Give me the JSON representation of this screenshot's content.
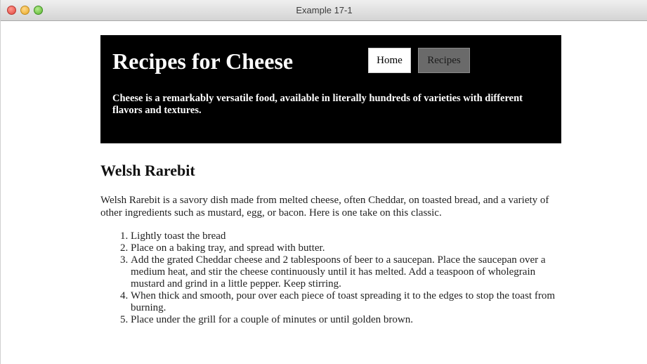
{
  "window": {
    "title": "Example 17-1"
  },
  "header": {
    "title": "Recipes for Cheese",
    "nav": {
      "home_label": "Home",
      "recipes_label": "Recipes"
    },
    "tagline": "Cheese is a remarkably versatile food, available in literally hundreds of varieties with different flavors and textures."
  },
  "article": {
    "title": "Welsh Rarebit",
    "intro": "Welsh Rarebit is a savory dish made from melted cheese, often Cheddar, on toasted bread, and a variety of other ingredients such as mustard, egg, or bacon. Here is one take on this classic.",
    "steps": [
      "Lightly toast the bread",
      "Place on a baking tray, and spread with butter.",
      "Add the grated Cheddar cheese and 2 tablespoons of beer to a saucepan. Place the saucepan over a medium heat, and stir the cheese continuously until it has melted. Add a teaspoon of wholegrain mustard and grind in a little pepper. Keep stirring.",
      "When thick and smooth, pour over each piece of toast spreading it to the edges to stop the toast from burning.",
      "Place under the grill for a couple of minutes or until golden brown."
    ]
  },
  "colors": {
    "banner_background": "#000000",
    "home_tab_background": "#ffffff",
    "recipes_tab_background": "#6a6a6a"
  }
}
